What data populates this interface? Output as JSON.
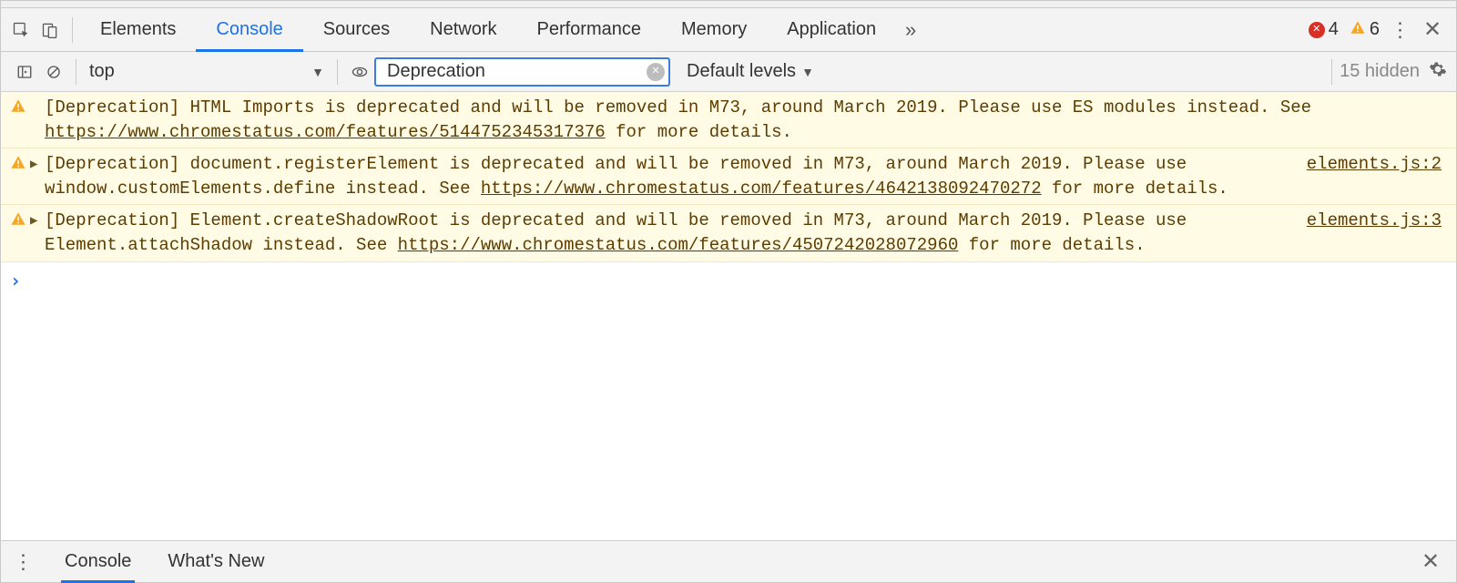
{
  "tabs": {
    "items": [
      "Elements",
      "Console",
      "Sources",
      "Network",
      "Performance",
      "Memory",
      "Application"
    ],
    "active_index": 1,
    "overflow_glyph": "»"
  },
  "status_badges": {
    "errors": "4",
    "warnings": "6"
  },
  "toolbar": {
    "context_label": "top",
    "filter_value": "Deprecation",
    "levels_label": "Default levels",
    "hidden_label": "15 hidden"
  },
  "messages": [
    {
      "kind": "warning",
      "disclosure": false,
      "source": "",
      "text_before_link": "[Deprecation] HTML Imports is deprecated and will be removed in M73, around March 2019. Please use ES modules instead. See ",
      "link": "https://www.chromestatus.com/features/5144752345317376",
      "text_after_link": " for more details."
    },
    {
      "kind": "warning",
      "disclosure": true,
      "source": "elements.js:2",
      "text_before_link": "[Deprecation] document.registerElement is deprecated and will be removed in M73, around March 2019. Please use window.customElements.define instead. See ",
      "link": "https://www.chromestatus.com/features/4642138092470272",
      "text_after_link": " for more details."
    },
    {
      "kind": "warning",
      "disclosure": true,
      "source": "elements.js:3",
      "text_before_link": "[Deprecation] Element.createShadowRoot is deprecated and will be removed in M73, around March 2019. Please use Element.attachShadow instead. See ",
      "link": "https://www.chromestatus.com/features/4507242028072960",
      "text_after_link": " for more details."
    }
  ],
  "prompt_glyph": "›",
  "drawer": {
    "tabs": [
      "Console",
      "What's New"
    ],
    "active_index": 0
  }
}
